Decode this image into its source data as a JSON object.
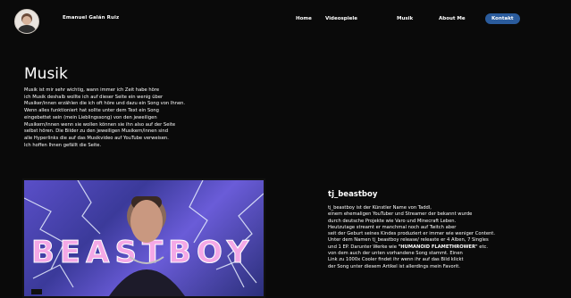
{
  "header": {
    "brand_name": "Emanuel Galán Ruiz",
    "nav": [
      {
        "label": "Home"
      },
      {
        "label": "Videospiele"
      },
      {
        "label": "Musik"
      },
      {
        "label": "About Me"
      },
      {
        "label": "Kontakt"
      }
    ]
  },
  "main": {
    "title": "Musik",
    "intro": "Musik ist mir sehr wichtig, wann immer ich Zeit habe höre\nich Musik deshalb wollte ich auf dieser Seite ein wenig über\nMusiker/innen erzählen die ich oft höre und dazu ein Song von Ihnen.\nWenn alles funktioniert hat sollte unter dem Text ein Song\neingebettet sein (mein Lieblingssong) von den jeweiligen\nMusikern/innen wenn sie wollen können sie ihn also auf der Seite\nselbst hören. Die Bilder zu den jeweiligen Musikern/innen sind\nalle Hyperlinks die auf das Musikvideo auf YouTube verweisen.\nIch hoffen Ihnen gefällt die Seite.",
    "artist": {
      "name": "tj_beastboy",
      "bio_part1": "tj_beastboy ist der Künstler Name von Taddl,\neinem ehemaligen YouTuber und Streamer der bekannt wurde\ndurch deutsche Projekte wie Varo und Minecraft Leben.\nHeutzutage streamt er manchmal noch auf Twitch aber\nseit der Geburt seines Kindes produziert er immer wie weniger Content.\nUnter dem Namen tj_beastboy release/ releaste er 4 Alben, 7 Singles\nund 1 EP. Darunter Werke wie ",
      "bio_highlight": "\"HUMANOID FLAMETHROWER\"",
      "bio_part2": " etc.\nvon dem auch der unten vorhandene Song stammt. Einen\nLink zu 1000x Cooler findet ihr wenn ihr auf das Bild klickt\nder Song unter diesem Artikel ist allerdings mein Favorit.",
      "cover_text": "BEASTBOY"
    }
  },
  "colors": {
    "background": "#0a0a0a",
    "nav_active": "#2a5b9c",
    "text": "#ffffff"
  }
}
